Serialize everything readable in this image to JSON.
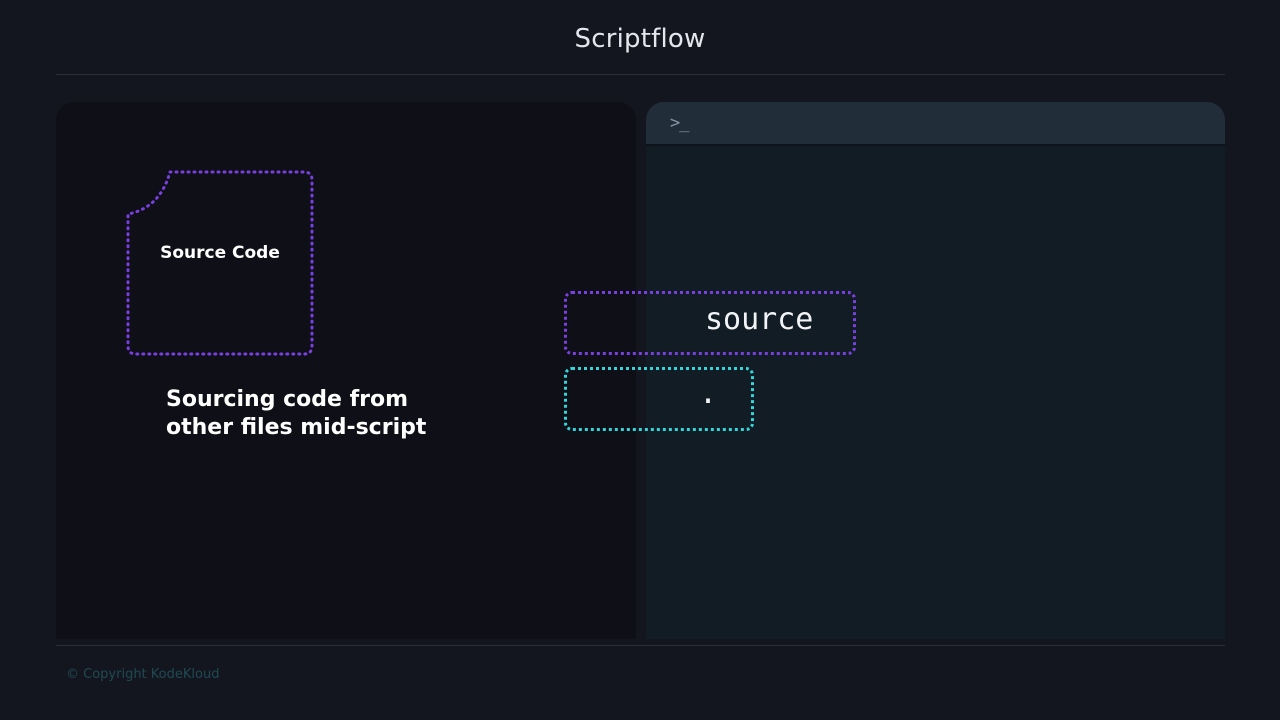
{
  "slide": {
    "title": "Scriptflow"
  },
  "left_panel": {
    "doc_label": "Source Code",
    "caption": "Sourcing code from other files mid-script"
  },
  "terminal": {
    "prompt_icon": ">_",
    "command": "source",
    "dot_command": "."
  },
  "footer": {
    "copyright": "© Copyright KodeKloud"
  },
  "colors": {
    "background": "#14161f",
    "left_panel": "#0e0f17",
    "terminal_body": "#121c24",
    "terminal_bar": "#222d3a",
    "purple_accent": "#7a3fe0",
    "cyan_accent": "#36d4d8"
  }
}
